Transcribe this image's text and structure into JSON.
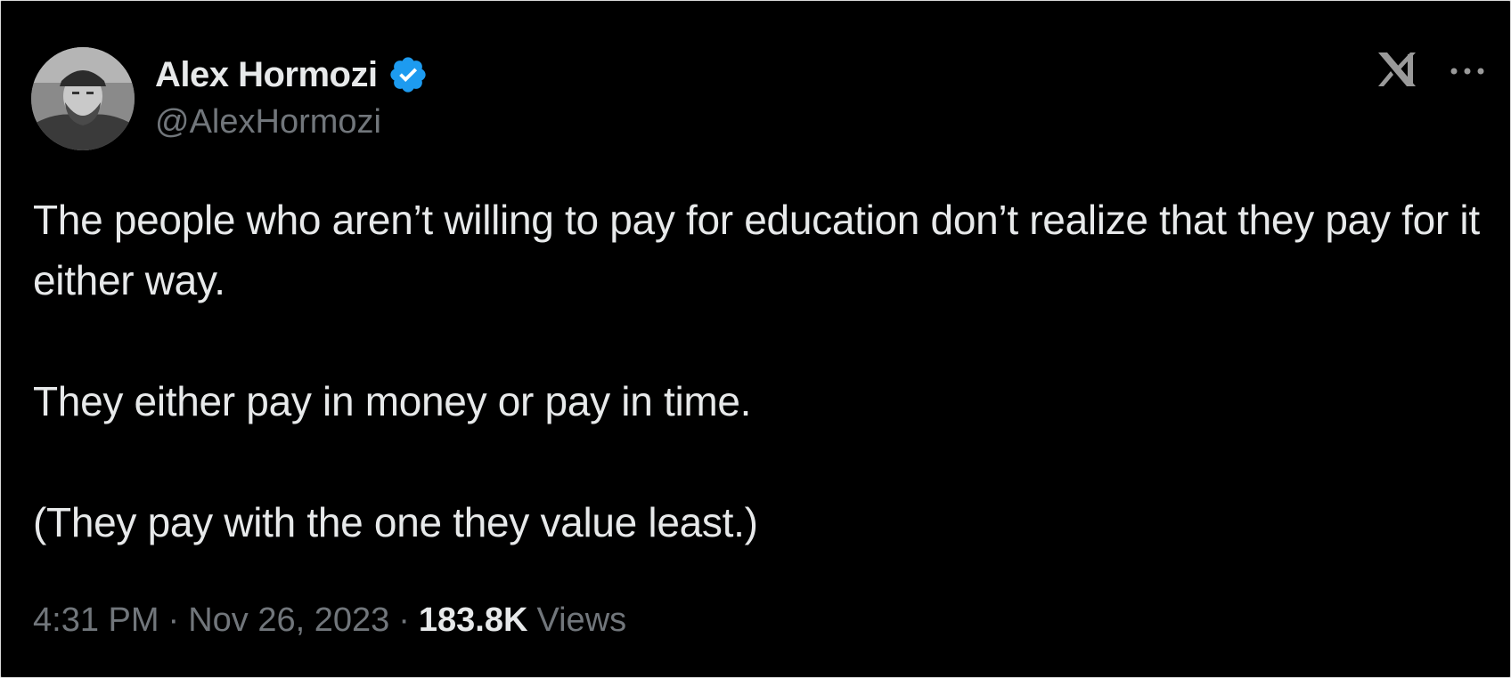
{
  "tweet": {
    "author": {
      "name": "Alex Hormozi",
      "handle": "@AlexHormozi",
      "verified": true,
      "verified_icon": "verified-badge-icon",
      "verified_color": "#1d9bf0"
    },
    "paragraphs": [
      "The people who aren’t willing to pay for education don’t realize that they pay for it either way.",
      "They either pay in money or pay in time.",
      "(They pay with the one they value least.)"
    ],
    "time": "4:31 PM",
    "separator": "·",
    "date": "Nov 26, 2023",
    "views_count": "183.8K",
    "views_label": "Views"
  },
  "header": {
    "logo_icon": "x-logo-icon",
    "more_icon": "more-options-icon"
  },
  "colors": {
    "background": "#000000",
    "primary_text": "#e7e9ea",
    "secondary_text": "#71767b",
    "accent": "#1d9bf0"
  }
}
